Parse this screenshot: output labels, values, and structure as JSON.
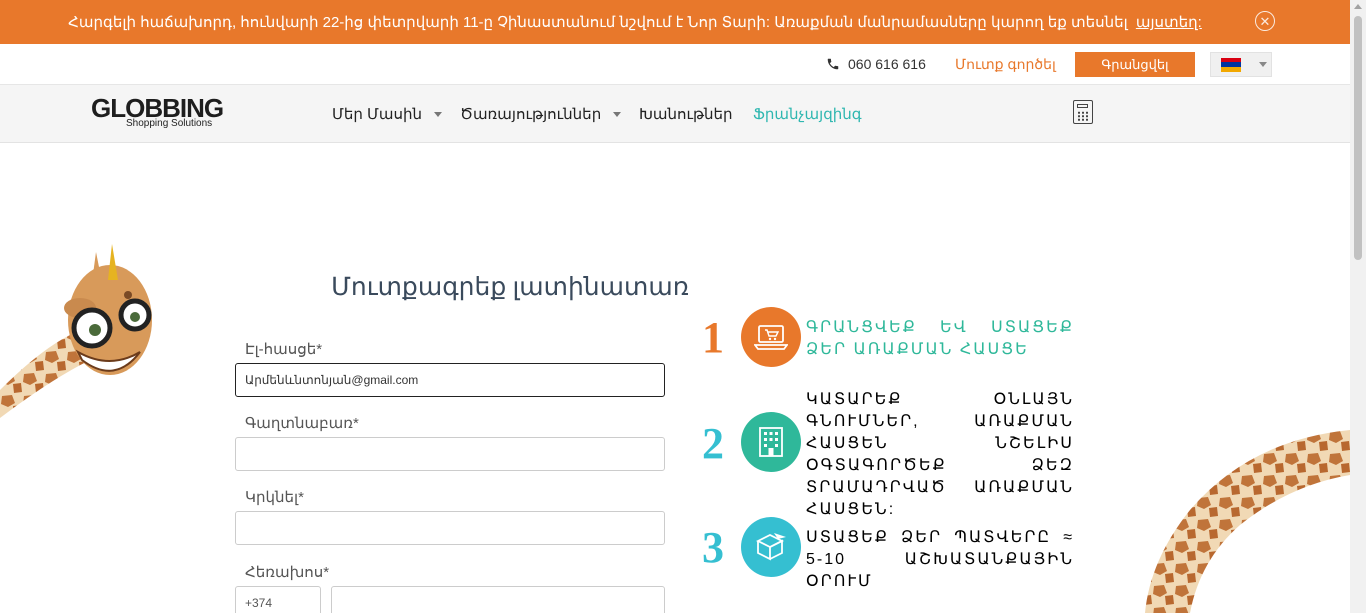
{
  "announcement": {
    "message": "Հարգելի հաճախորդ, հունվարի 22-ից փետրվարի 11-ը Չինաստանում նշվում է Նոր Տարի: Առաքման մանրամասները կարող եք տեսնել",
    "link": "այստեղ:",
    "close_icon": "close-circle-icon"
  },
  "topbar": {
    "phone": "060 616 616",
    "phone_icon": "phone-icon",
    "login": "Մուտք գործել",
    "register": "Գրանցվել",
    "language_flag": {
      "colors": [
        "#d90012",
        "#0033a0",
        "#f2a800"
      ]
    }
  },
  "nav": {
    "logo": "GLOBBING",
    "logo_sub": "Shopping Solutions",
    "items": [
      {
        "label": "Մեր Մասին",
        "dropdown": true,
        "active": false
      },
      {
        "label": "Ծառայություններ",
        "dropdown": true,
        "active": false
      },
      {
        "label": "Խանութներ",
        "dropdown": false,
        "active": false
      },
      {
        "label": "Ֆրանչայզինգ",
        "dropdown": false,
        "active": true
      }
    ],
    "calculator_icon": "calculator-icon"
  },
  "form": {
    "title": "Մուտքագրեք լատինատառ",
    "email_label": "Էլ-հասցե*",
    "email_value": "Արմենևնտոնյան@gmail.com",
    "password_label": "Գաղտնաբառ*",
    "password_value": "",
    "repeat_label": "Կրկնել*",
    "repeat_value": "",
    "phone_label": "Հեռախոս*",
    "phone_code": "+374",
    "phone_value": ""
  },
  "steps": [
    {
      "number": "1",
      "text": "ԳՐԱՆՑՎԵՔ ԵՎ ՍՏԱՑԵՔ ՁԵՐ ԱՌԱՔՄԱՆ ՀԱՍՑԵ",
      "color": "#e8782b",
      "icon": "laptop-cart-icon"
    },
    {
      "number": "2",
      "text": "ԿԱՏԱՐԵՔ ՕՆԼԱՅՆ ԳՆՈՒՄՆԵՐ, ԱՌԱՔՄԱՆ ՀԱՍՑԵՆ ՆՇԵԼԻՍ ՕԳՏԱԳՈՐԾԵՔ ՁԵԶ ՏՐԱՄԱԴՐՎԱԾ ԱՌԱՔՄԱՆ ՀԱՍՑԵՆ:",
      "color": "#2fb89a",
      "icon": "building-icon"
    },
    {
      "number": "3",
      "text": "ՍՏԱՑԵՔ ՁԵՐ ՊԱՏՎԵՐԸ ≈ 5-10 ԱՇԽԱՏԱՆՔԱՅԻՆ ՕՐՈՒՄ",
      "color": "#35bfd1",
      "icon": "plane-box-icon"
    }
  ]
}
